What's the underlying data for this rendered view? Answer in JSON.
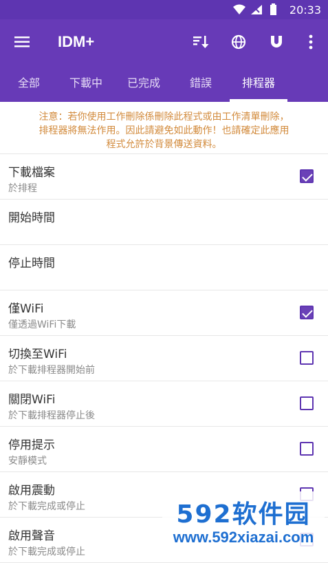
{
  "status_bar": {
    "time": "20:33",
    "icons": [
      "wifi-icon",
      "signal-icon",
      "battery-icon"
    ]
  },
  "app_bar": {
    "title": "IDM+",
    "icons": [
      "menu-icon",
      "sort-icon",
      "globe-icon",
      "magnet-icon",
      "more-vert-icon"
    ]
  },
  "tabs": [
    {
      "label": "全部"
    },
    {
      "label": "下載中"
    },
    {
      "label": "已完成"
    },
    {
      "label": "錯誤"
    },
    {
      "label": "排程器"
    }
  ],
  "active_tab": "排程器",
  "notice": {
    "line1": "注意：若你使用工作刪除係刪除此程式或由工作清單刪除，",
    "line2": "排程器將無法作用。因此請避免如此動作！也請確定此應用",
    "line3": "程式允許於背景傳送資料。"
  },
  "settings": [
    {
      "title": "下載檔案",
      "subtitle": "於排程",
      "checkbox": true,
      "checked": true
    },
    {
      "title": "開始時間",
      "subtitle": "",
      "checkbox": false,
      "checked": false
    },
    {
      "title": "停止時間",
      "subtitle": "",
      "checkbox": false,
      "checked": false
    },
    {
      "title": "僅WiFi",
      "subtitle": "僅透過WiFi下載",
      "checkbox": true,
      "checked": true
    },
    {
      "title": "切換至WiFi",
      "subtitle": "於下載排程器開始前",
      "checkbox": true,
      "checked": false
    },
    {
      "title": "關閉WiFi",
      "subtitle": "於下載排程器停止後",
      "checkbox": true,
      "checked": false
    },
    {
      "title": "停用提示",
      "subtitle": "安靜模式",
      "checkbox": true,
      "checked": false
    },
    {
      "title": "啟用震動",
      "subtitle": "於下載完成或停止",
      "checkbox": true,
      "checked": false
    },
    {
      "title": "啟用聲音",
      "subtitle": "於下載完成或停止",
      "checkbox": true,
      "checked": false
    }
  ],
  "watermark": {
    "brand": "592软件园",
    "url": "www.592xiazai.com"
  },
  "colors": {
    "primary": "#673ab7",
    "status_bar": "#5e35b1",
    "notice_text": "#d28a3b",
    "accent": "#6a41b7"
  }
}
